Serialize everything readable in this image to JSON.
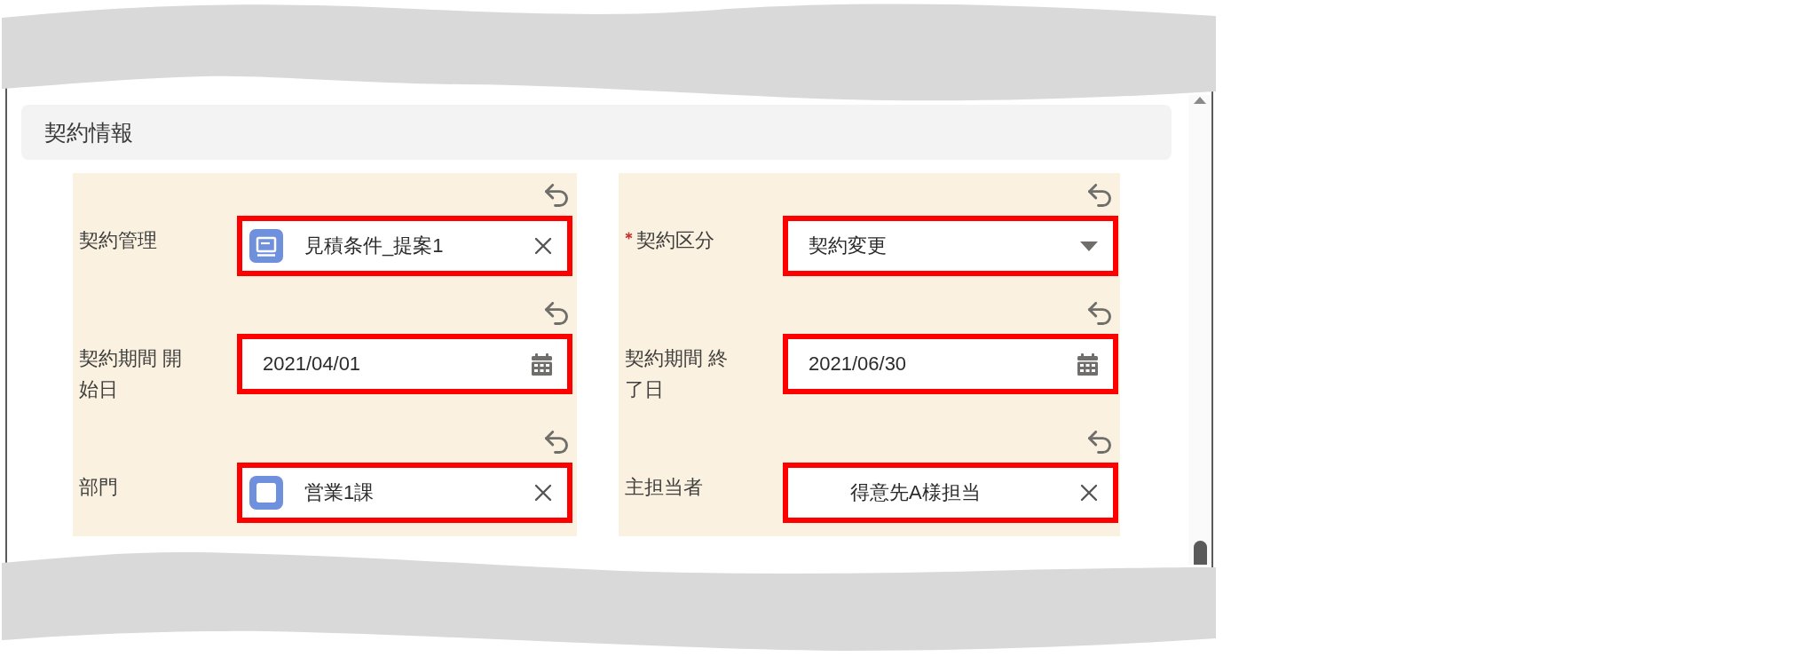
{
  "section": {
    "title": "契約情報"
  },
  "columns": [
    {
      "fields": [
        {
          "kind": "record-lookup",
          "label": "契約管理",
          "required": false,
          "value": "見積条件_提案1",
          "highlighted": true
        },
        {
          "kind": "date",
          "label": "契約期間 開始日",
          "required": false,
          "value": "2021/04/01",
          "highlighted": true
        },
        {
          "kind": "group-lookup",
          "label": "部門",
          "required": false,
          "value": "営業1課",
          "highlighted": true
        }
      ]
    },
    {
      "fields": [
        {
          "kind": "picklist",
          "label": "契約区分",
          "required": true,
          "value": "契約変更",
          "highlighted": true
        },
        {
          "kind": "date",
          "label": "契約期間 終了日",
          "required": false,
          "value": "2021/06/30",
          "highlighted": true
        },
        {
          "kind": "user-lookup",
          "label": "主担当者",
          "required": false,
          "value": "得意先A様担当",
          "highlighted": true
        }
      ]
    }
  ]
}
